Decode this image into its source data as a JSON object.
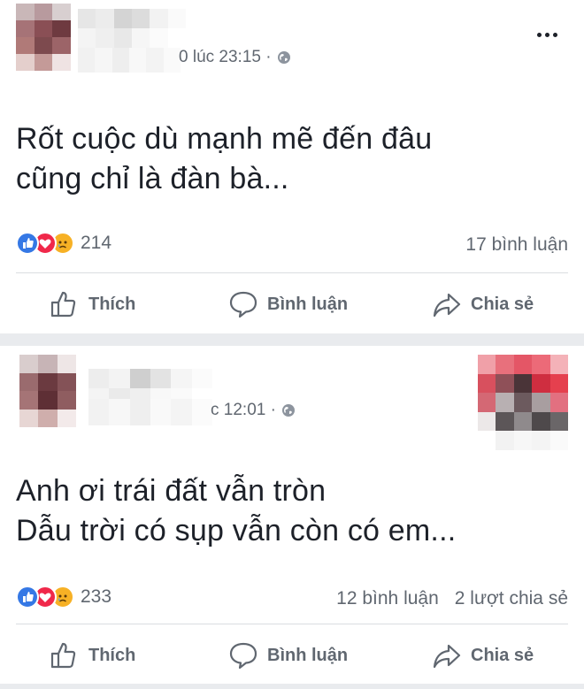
{
  "posts": [
    {
      "timestamp": "0 lúc 23:15 ·",
      "text_lines": [
        "Rốt cuộc dù mạnh mẽ đến đâu",
        "cũng chỉ là đàn bà..."
      ],
      "reaction_count": "214",
      "comments": "17 bình luận",
      "shares": "",
      "actions": {
        "like": "Thích",
        "comment": "Bình luận",
        "share": "Chia sẻ"
      }
    },
    {
      "timestamp": "c 12:01 ·",
      "text_lines": [
        "Anh ơi trái đất vẫn tròn",
        "Dẫu trời có sụp vẫn còn có em..."
      ],
      "reaction_count": "233",
      "comments": "12 bình luận",
      "shares": "2 lượt chia sẻ",
      "actions": {
        "like": "Thích",
        "comment": "Bình luận",
        "share": "Chia sẻ"
      }
    }
  ],
  "icons": {
    "reactions": [
      "like-icon",
      "love-icon",
      "sad-icon"
    ],
    "privacy": "globe-icon",
    "more": "more-options-icon",
    "like": "thumbs-up-icon",
    "comment": "speech-bubble-icon",
    "share": "share-arrow-icon"
  },
  "colors": {
    "like_blue": "#3578e5",
    "love_red": "#f0284a",
    "sad_yellow": "#f7b125",
    "muted_text": "#606770",
    "separator": "#e9ebee"
  }
}
